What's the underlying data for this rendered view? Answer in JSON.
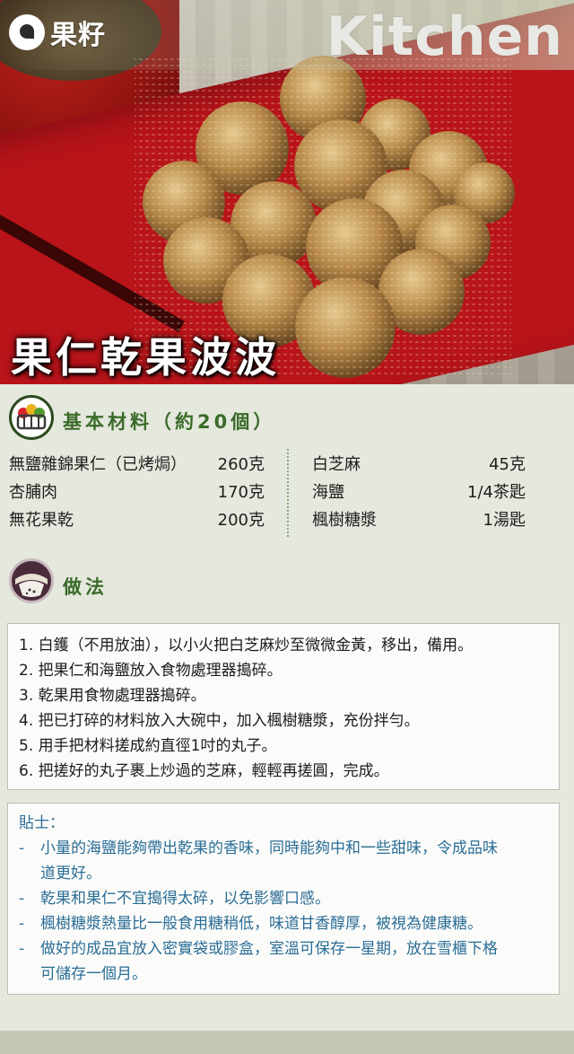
{
  "header": {
    "logo_text": "果籽",
    "section_word": "Kitchen"
  },
  "recipe_title": "果仁乾果波波",
  "ingredients": {
    "heading": "基本材料（約20個）",
    "left": [
      {
        "name": "無鹽雜錦果仁（已烤焗）",
        "amount": "260克"
      },
      {
        "name": "杏脯肉",
        "amount": "170克"
      },
      {
        "name": "無花果乾",
        "amount": "200克"
      }
    ],
    "right": [
      {
        "name": "白芝麻",
        "amount": "45克"
      },
      {
        "name": "海鹽",
        "amount": "1/4茶匙"
      },
      {
        "name": "楓樹糖漿",
        "amount": "1湯匙"
      }
    ]
  },
  "method": {
    "heading": "做法",
    "steps": [
      "1. 白鑊（不用放油），以小火把白芝麻炒至微微金黃，移出，備用。",
      "2. 把果仁和海鹽放入食物處理器搗碎。",
      "3. 乾果用食物處理器搗碎。",
      "4. 把已打碎的材料放入大碗中，加入楓樹糖漿，充份拌勻。",
      "5. 用手把材料搓成約直徑1吋的丸子。",
      "6. 把搓好的丸子裹上炒過的芝麻，輕輕再搓圓，完成。"
    ]
  },
  "tips": {
    "heading": "貼士：",
    "items": [
      [
        "小量的海鹽能夠帶出乾果的香味，同時能夠中和一些甜味，令成品味",
        "道更好。"
      ],
      [
        "乾果和果仁不宜搗得太碎，以免影響口感。"
      ],
      [
        "楓樹糖漿熱量比一般食用糖稍低，味道甘香醇厚，被視為健康糖。"
      ],
      [
        "做好的成品宜放入密實袋或膠盒，室溫可保存一星期，放在雪櫃下格",
        "可儲存一個月。"
      ]
    ]
  },
  "colors": {
    "accent_green": "#3b6b2a",
    "tip_blue": "#2b6d96",
    "plate_red": "#b8141a"
  }
}
